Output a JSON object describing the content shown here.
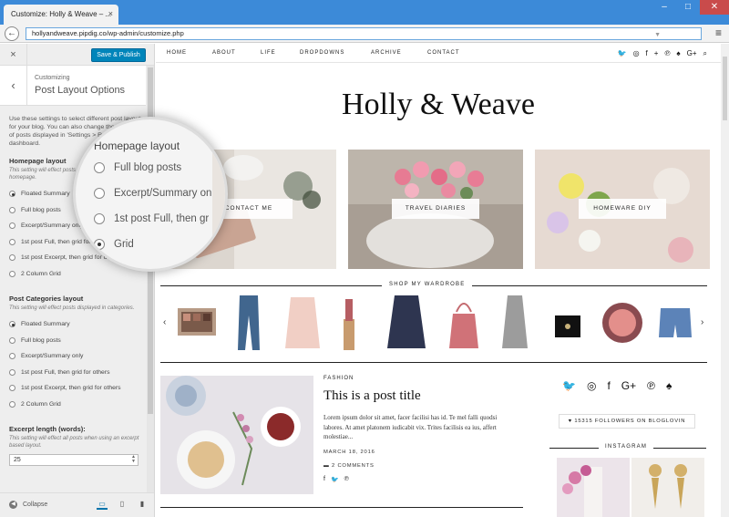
{
  "browser": {
    "tab_title": "Customize: Holly & Weave – ...",
    "tab_close": "×",
    "url": "hollyandweave.pipdig.co/wp-admin/customize.php",
    "back": "←",
    "menu": "≡",
    "min": "–",
    "max": "□",
    "close": "✕"
  },
  "customizer": {
    "close": "×",
    "publish_label": "Save & Publish",
    "back": "‹",
    "breadcrumb": "Customizing",
    "title": "Post Layout Options",
    "description": "Use these settings to select different post layouts for your blog. You can also change the number of posts displayed in 'Settings > Reading' in your dashboard.",
    "homepage_label": "Homepage layout",
    "homepage_sub": "This setting will effect posts displayed on the homepage.",
    "homepage_options": [
      {
        "label": "Floated Summary",
        "checked": true
      },
      {
        "label": "Full blog posts",
        "checked": false
      },
      {
        "label": "Excerpt/Summary only",
        "checked": false
      },
      {
        "label": "1st post Full, then grid for others",
        "checked": false
      },
      {
        "label": "1st post Excerpt, then grid for others",
        "checked": false
      },
      {
        "label": "2 Column Grid",
        "checked": false
      }
    ],
    "categories_label": "Post Categories layout",
    "categories_sub": "This setting will effect posts displayed in categories.",
    "categories_options": [
      {
        "label": "Floated Summary",
        "checked": true
      },
      {
        "label": "Full blog posts",
        "checked": false
      },
      {
        "label": "Excerpt/Summary only",
        "checked": false
      },
      {
        "label": "1st post Full, then grid for others",
        "checked": false
      },
      {
        "label": "1st post Excerpt, then grid for others",
        "checked": false
      },
      {
        "label": "2 Column Grid",
        "checked": false
      }
    ],
    "excerpt_label": "Excerpt length (words):",
    "excerpt_sub": "This setting will effect all posts when using an excerpt based layout.",
    "excerpt_value": "25",
    "collapse_label": "Collapse"
  },
  "magnifier": {
    "title": "Homepage layout",
    "options": [
      {
        "label": "Full blog posts",
        "checked": false
      },
      {
        "label": "Excerpt/Summary on",
        "checked": false
      },
      {
        "label": "1st post Full, then gr",
        "checked": false
      },
      {
        "label": "Grid",
        "checked": true
      }
    ]
  },
  "site": {
    "nav": [
      "HOME",
      "ABOUT",
      "LIFE",
      "DROPDOWNS",
      "ARCHIVE",
      "CONTACT"
    ],
    "title": "Holly & Weave",
    "categories": [
      "CONTACT ME",
      "TRAVEL DIARIES",
      "HOMEWARE DIY"
    ],
    "shop_title": "SHOP MY WARDROBE",
    "post": {
      "category": "FASHION",
      "title": "This is a post title",
      "excerpt": "Lorem ipsum dolor sit amet, facer facilisi has id. Te mel falli quodsi labores. At amet platonem iudicabit vix. Trites facilisis ea ius, affert molestiae...",
      "date": "MARCH 18, 2016",
      "comments": "2 COMMENTS"
    },
    "followers": "15315 FOLLOWERS ON BLOGLOVIN",
    "instagram_title": "INSTAGRAM"
  },
  "colors": {
    "chrome_blue": "#3c8ad8",
    "publish_blue": "#0085ba",
    "sidebar_bg": "#eeeeee"
  }
}
